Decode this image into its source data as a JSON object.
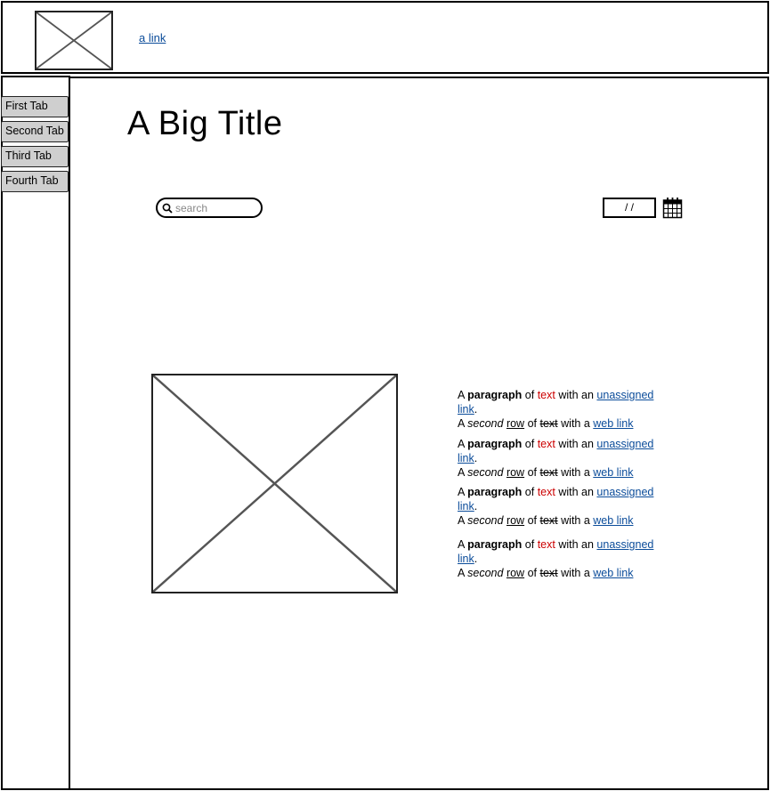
{
  "header": {
    "link_text": "a link"
  },
  "sidebar": {
    "tabs": [
      {
        "label": "First Tab"
      },
      {
        "label": "Second Tab"
      },
      {
        "label": "Third Tab"
      },
      {
        "label": "Fourth Tab"
      }
    ]
  },
  "main": {
    "title": "A Big Title",
    "search": {
      "placeholder": "search",
      "value": ""
    },
    "date": {
      "value": " /  /"
    },
    "icons": {
      "search": "search-icon",
      "calendar": "calendar-icon",
      "image": "image-placeholder-icon"
    },
    "paragraph": {
      "w_a": "A",
      "w_paragraph": "paragraph",
      "w_of": "of",
      "w_text": "text",
      "w_with_an": "with an",
      "w_unassigned": "unassigned",
      "w_link": "link",
      "w_period": ".",
      "w_second": "second",
      "w_row": "row",
      "w_with_a": "with a",
      "w_web_link": "web link"
    }
  },
  "colors": {
    "link": "#0b4c9a",
    "red_text": "#cc0000",
    "tab_background": "#cfcfcf"
  }
}
